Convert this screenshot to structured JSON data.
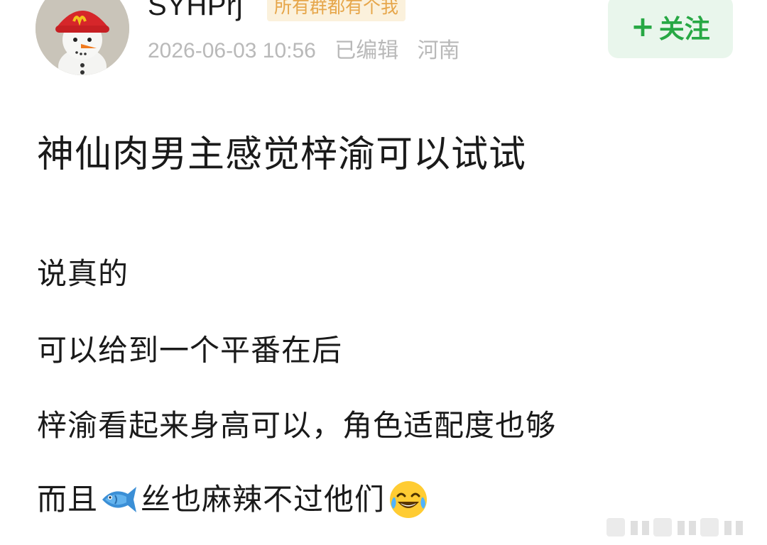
{
  "header": {
    "username": "SYHPrj",
    "group_badge": "所有群都有个我",
    "meta": {
      "datetime": "2026-06-03 10:56",
      "edited": "已编辑",
      "location": "河南"
    },
    "follow_button": "关注",
    "follow_plus": "+"
  },
  "post": {
    "title": "神仙肉男主感觉梓渝可以试试",
    "lines": {
      "l1": "说真的",
      "l2": "可以给到一个平番在后",
      "l3": "梓渝看起来身高可以，角色适配度也够",
      "l4_before": "而且",
      "l4_mid": "丝也麻辣不过他们"
    },
    "emojis": [
      "fish-emoji",
      "tears-of-joy-emoji"
    ]
  },
  "colors": {
    "accent_green": "#27a844",
    "follow_bg": "#e9f6ec",
    "badge_text": "#e6a64a",
    "badge_bg": "#fbf1dc",
    "meta_gray": "#b9b9b9"
  },
  "icons": [
    "avatar-snowman",
    "fish-emoji",
    "tears-of-joy-emoji",
    "weibo-watermark"
  ]
}
